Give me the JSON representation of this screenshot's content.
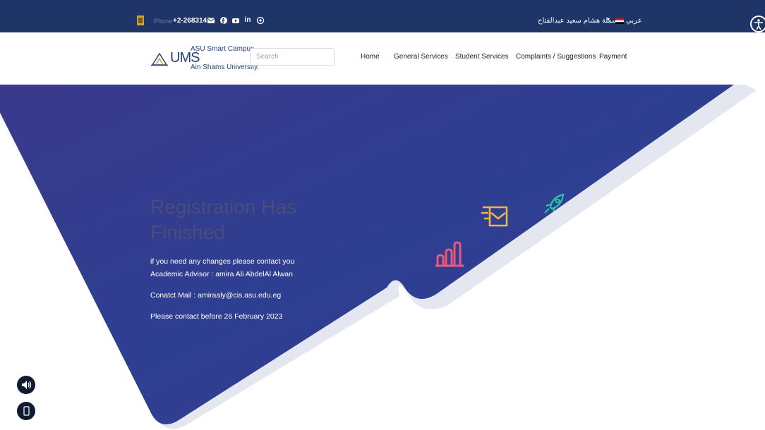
{
  "topbar": {
    "phone_label": "Phone",
    "phone": "+2-26831474",
    "social_icons": [
      "mail-icon",
      "facebook-icon",
      "youtube-icon",
      "linkedin-icon",
      "instagram-icon"
    ],
    "social_glyphs": {
      "linkedin": "in"
    },
    "user_name": "بسملة هشام سعيد عبدالفتاح",
    "language": "عربي",
    "background": "#1f3568"
  },
  "nav": {
    "logo": {
      "brand": "UMS",
      "line1": "ASU Smart Campus",
      "line2": "Ain Shams University."
    },
    "search": {
      "placeholder": "Search",
      "value": ""
    },
    "links": [
      "Home",
      "General Services",
      "Student Services",
      "Complaints / Suggestions",
      "Payment"
    ]
  },
  "hero": {
    "background": "#3b3c8f",
    "title": "Registration Has Finished",
    "lines": [
      "if you need any changes please contact you",
      "Academic Advisor : amira Ali AbdelAl Alwan",
      "Conatct Mail : amiraaly@cis.asu.edu.eg",
      "Please contact before 26 February 2023"
    ],
    "icons": [
      "mail-fast-icon",
      "rocket-icon",
      "chart-icon"
    ],
    "icon_colors": {
      "mail": "#f3b73b",
      "rocket": "#2ec4a4",
      "chart": "#e75a78"
    }
  },
  "floating": {
    "buttons": [
      "speaker-icon",
      "mobile-icon"
    ]
  }
}
